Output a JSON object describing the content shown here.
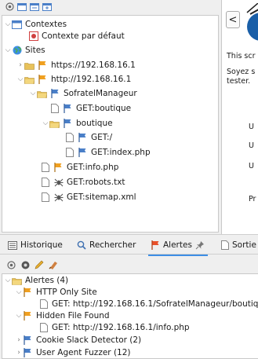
{
  "tree": {
    "contexts_label": "Contextes",
    "default_context_label": "Contexte par défaut",
    "sites_label": "Sites",
    "site_https": "https://192.168.16.1",
    "site_http": "http://192.168.16.1",
    "folder_sofratel": "SofratelManageur",
    "get_boutique": "GET:boutique",
    "folder_boutique": "boutique",
    "get_root": "GET:/",
    "get_index": "GET:index.php",
    "get_info": "GET:info.php",
    "get_robots": "GET:robots.txt",
    "get_sitemap": "GET:sitemap.xml"
  },
  "right": {
    "back_label": "<",
    "line1": "This scr",
    "line2": "Soyez s",
    "line3": "tester.",
    "u1": "U",
    "u2": "U",
    "u3": "U",
    "p": "Pr"
  },
  "tabs": {
    "history": "Historique",
    "search": "Rechercher",
    "alerts": "Alertes",
    "output": "Sortie"
  },
  "alerts": {
    "root": "Alertes (4)",
    "http_only": "HTTP Only Site",
    "http_only_child": "GET: http://192.168.16.1/SofratelManageur/boutique",
    "hidden_file": "Hidden File Found",
    "hidden_file_child": "GET: http://192.168.16.1/info.php",
    "cookie_slack": "Cookie Slack Detector (2)",
    "ua_fuzzer": "User Agent Fuzzer (12)"
  },
  "colors": {
    "accent": "#3d8ee5",
    "flag_orange": "#f0a020",
    "flag_blue": "#4a7fc8",
    "folder": "#e8c25a"
  }
}
